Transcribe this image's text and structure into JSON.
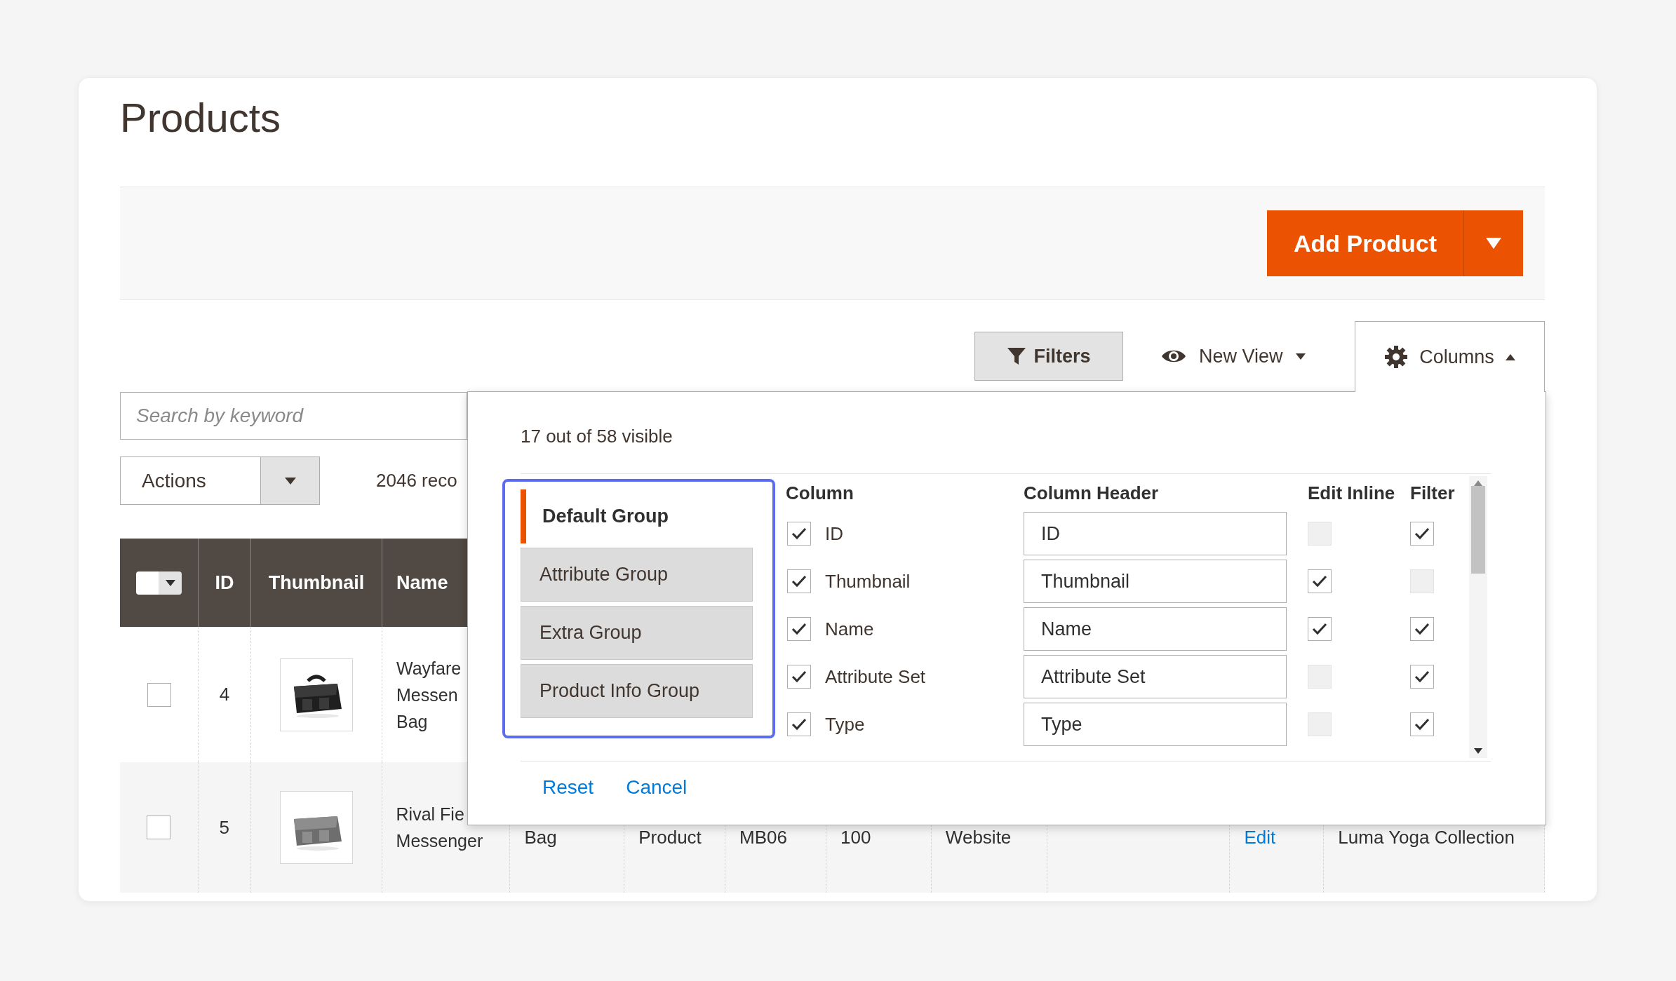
{
  "page_title": "Products",
  "add_product": {
    "label": "Add Product"
  },
  "toolbar": {
    "filters": "Filters",
    "view": "New View",
    "columns": {
      "label": "Columns",
      "expanded": true
    }
  },
  "search": {
    "placeholder": "Search by keyword"
  },
  "actions": {
    "label": "Actions"
  },
  "records": "2046 reco",
  "table": {
    "columns": [
      "ID",
      "Thumbnail",
      "Name"
    ],
    "rows": [
      {
        "checked": false,
        "id": "4",
        "thumbnail": {
          "kind": "picture"
        },
        "name": [
          "Wayfare",
          "Messen",
          "Bag"
        ]
      },
      {
        "checked": false,
        "id": "5",
        "thumbnail": {
          "kind": "picture"
        },
        "name": [
          "Rival Fie",
          "Messenger"
        ],
        "cells": [
          {
            "kind": "text",
            "text": "Bag"
          },
          {
            "kind": "text",
            "text": "Product"
          },
          {
            "kind": "text",
            "text": "MB06"
          },
          {
            "kind": "text",
            "text": "100"
          },
          {
            "kind": "text",
            "text": "Website"
          },
          {
            "kind": "empty"
          },
          {
            "kind": "link",
            "text": "Edit"
          },
          {
            "kind": "text",
            "text": "Luma Yoga Collection"
          }
        ]
      }
    ]
  },
  "columns_panel": {
    "visible_count": "17 out of 58 visible",
    "groups": [
      {
        "label": "Default Group",
        "selected": true
      },
      {
        "label": "Attribute Group",
        "selected": false
      },
      {
        "label": "Extra Group",
        "selected": false
      },
      {
        "label": "Product Info Group",
        "selected": false
      }
    ],
    "headers": [
      "Column",
      "Column Header",
      "Edit Inline",
      "Filter"
    ],
    "rows": [
      {
        "visible": true,
        "label": "ID",
        "header": "ID",
        "edit_inline": false,
        "filter": true
      },
      {
        "visible": true,
        "label": "Thumbnail",
        "header": "Thumbnail",
        "edit_inline": true,
        "filter": false
      },
      {
        "visible": true,
        "label": "Name",
        "header": "Name",
        "edit_inline": true,
        "filter": true
      },
      {
        "visible": true,
        "label": "Attribute Set",
        "header": "Attribute Set",
        "edit_inline": false,
        "filter": true
      },
      {
        "visible": true,
        "label": "Type",
        "header": "Type",
        "edit_inline": false,
        "filter": true
      }
    ],
    "buttons": [
      "Reset",
      "Cancel"
    ]
  }
}
